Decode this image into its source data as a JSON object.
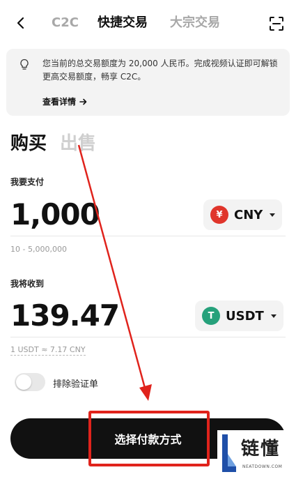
{
  "nav": {
    "tabs": [
      "C2C",
      "快捷交易",
      "大宗交易"
    ]
  },
  "banner": {
    "text": "您当前的总交易额度为 20,000 人民币。完成视频认证即可解锁更高交易额度，畅享 C2C。",
    "link": "查看详情"
  },
  "trade": {
    "buy": "购买",
    "sell": "出售"
  },
  "pay": {
    "label": "我要支付",
    "amount": "1,000",
    "currency": "CNY",
    "currency_symbol": "¥",
    "currency_color": "#e0352b",
    "range": "10 - 5,000,000"
  },
  "receive": {
    "label": "我将收到",
    "amount": "139.47",
    "currency": "USDT",
    "currency_symbol": "T",
    "currency_color": "#26a17b"
  },
  "rate": "1 USDT ≈ 7.17 CNY",
  "filter": {
    "label": "排除验证单",
    "enabled": false
  },
  "cta": "选择付款方式",
  "watermark": {
    "brand": "链懂",
    "url": "NEATDOWN.COM"
  },
  "colors": {
    "annotation_red": "#e0231c",
    "primary_button": "#111111"
  }
}
